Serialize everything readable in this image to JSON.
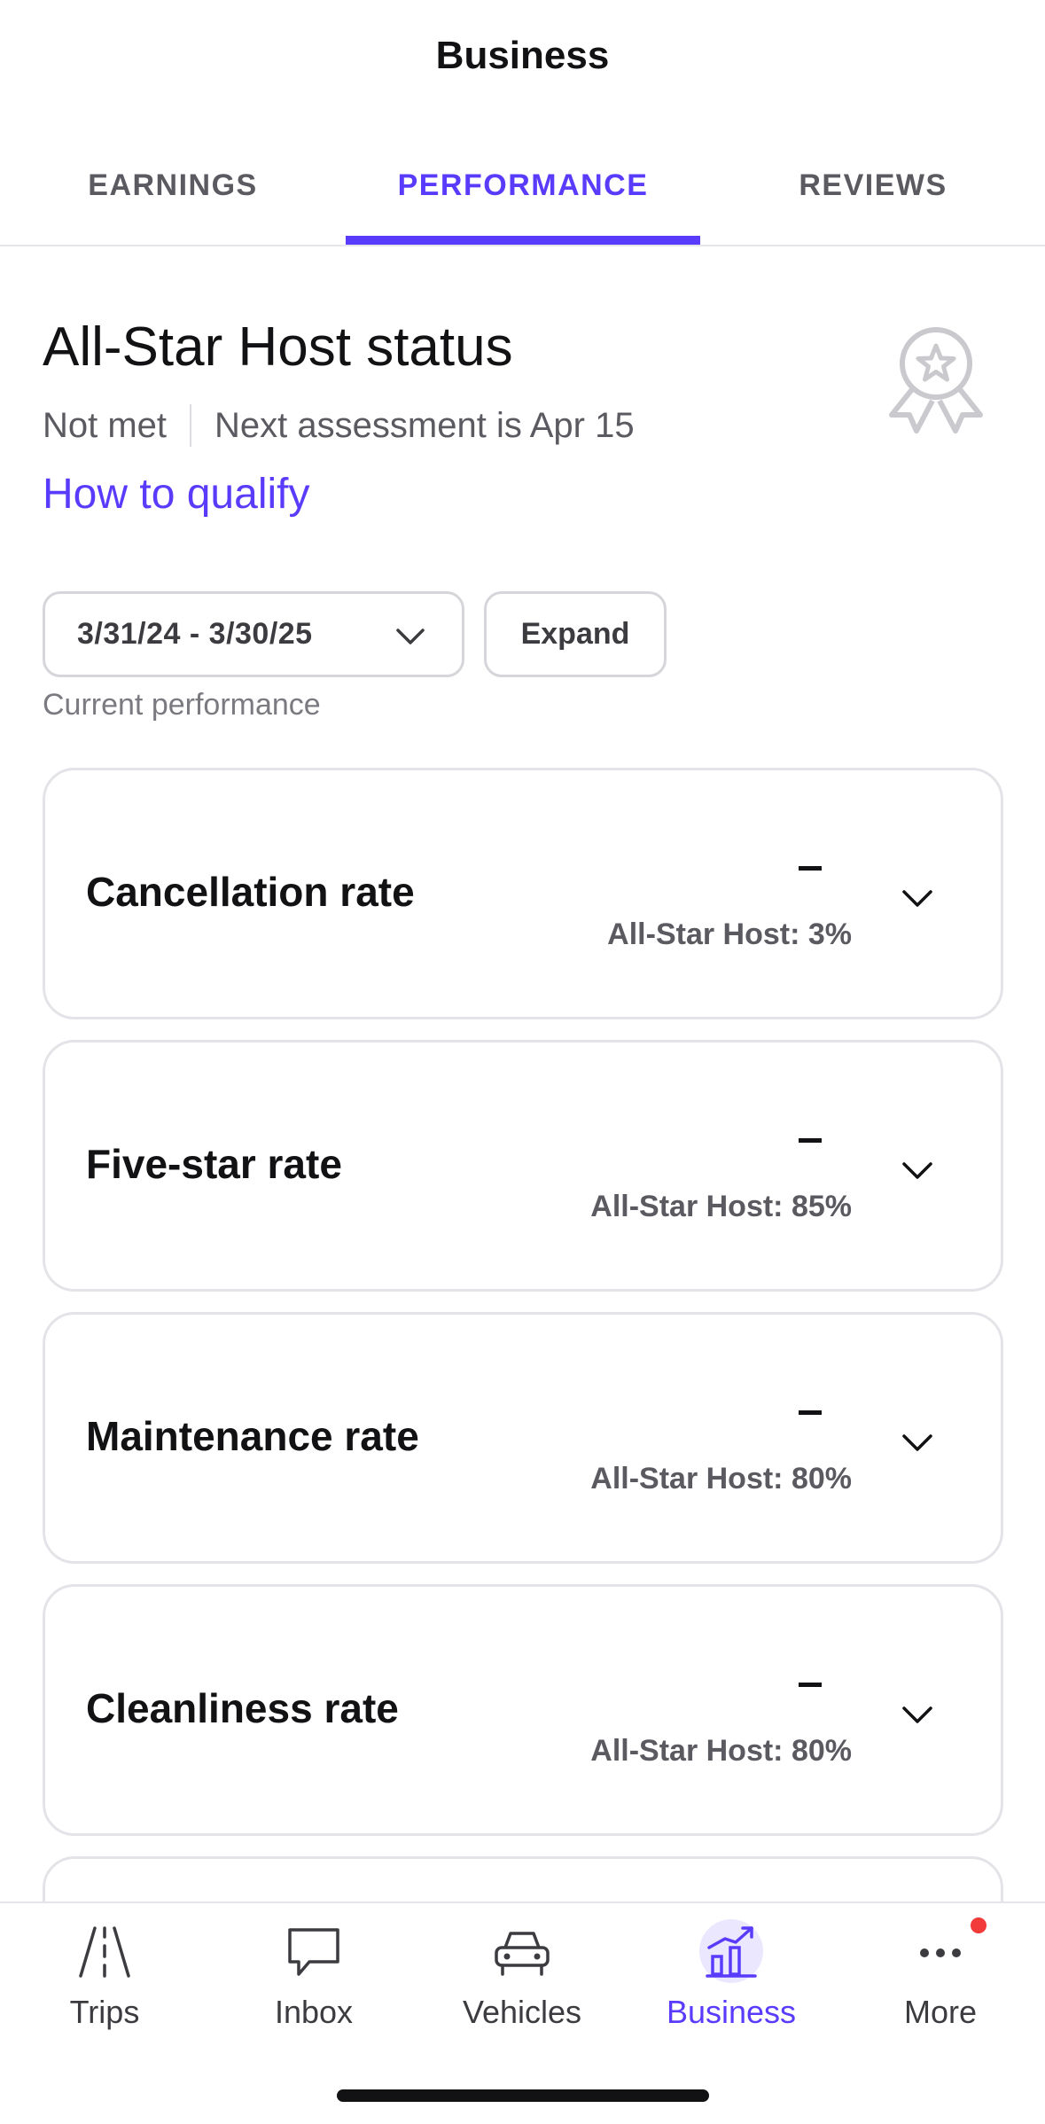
{
  "header": {
    "title": "Business"
  },
  "tabs": [
    {
      "label": "EARNINGS",
      "active": false
    },
    {
      "label": "PERFORMANCE",
      "active": true
    },
    {
      "label": "REVIEWS",
      "active": false
    }
  ],
  "status": {
    "title": "All-Star Host status",
    "state": "Not met",
    "next_assessment": "Next assessment is Apr 15",
    "qualify_link": "How to qualify",
    "badge_icon": "award-ribbon-icon"
  },
  "controls": {
    "date_range": "3/31/24 - 3/30/25",
    "expand_label": "Expand",
    "caption": "Current performance"
  },
  "metrics": [
    {
      "label": "Cancellation rate",
      "value": "–",
      "target": "All-Star Host: 3%"
    },
    {
      "label": "Five-star rate",
      "value": "–",
      "target": "All-Star Host: 85%"
    },
    {
      "label": "Maintenance rate",
      "value": "–",
      "target": "All-Star Host: 80%"
    },
    {
      "label": "Cleanliness rate",
      "value": "–",
      "target": "All-Star Host: 80%"
    }
  ],
  "nav": [
    {
      "label": "Trips",
      "icon": "road-icon",
      "active": false
    },
    {
      "label": "Inbox",
      "icon": "chat-bubble-icon",
      "active": false
    },
    {
      "label": "Vehicles",
      "icon": "car-icon",
      "active": false
    },
    {
      "label": "Business",
      "icon": "bar-chart-trend-icon",
      "active": true
    },
    {
      "label": "More",
      "icon": "more-dots-icon",
      "active": false,
      "has_notification": true
    }
  ],
  "colors": {
    "accent": "#593cfb",
    "notification": "#f23c3c"
  }
}
